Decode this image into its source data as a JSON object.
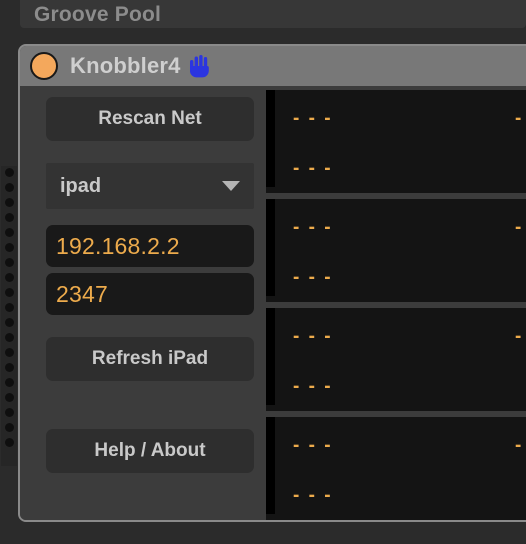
{
  "ableton": {
    "groove_pool_label": "Groove Pool"
  },
  "device": {
    "title": "Knobbler4",
    "power_icon": "power-circle-icon",
    "hand_icon": "raised-hand-icon",
    "power_color": "#f4a85c",
    "hand_color": "#2b35e0",
    "titlebar_color": "#787878"
  },
  "controls": {
    "rescan_label": "Rescan Net",
    "device_select": {
      "value": "ipad",
      "arrow_icon": "chevron-down-icon"
    },
    "ip_address": {
      "value": "192.168.2.2",
      "placeholder": "192.168.2.2"
    },
    "port": {
      "value": "2347",
      "placeholder": "2347"
    },
    "refresh_label": "Refresh iPad",
    "help_label": "Help / About",
    "accent_color": "#edab4c"
  },
  "param_rows": [
    {
      "name": "- - -",
      "value": "- - -",
      "sub": "- - -"
    },
    {
      "name": "- - -",
      "value": "- - -",
      "sub": "- - -"
    },
    {
      "name": "- - -",
      "value": "- - -",
      "sub": "- - -"
    },
    {
      "name": "- - -",
      "value": "- - -",
      "sub": "- - -"
    }
  ]
}
